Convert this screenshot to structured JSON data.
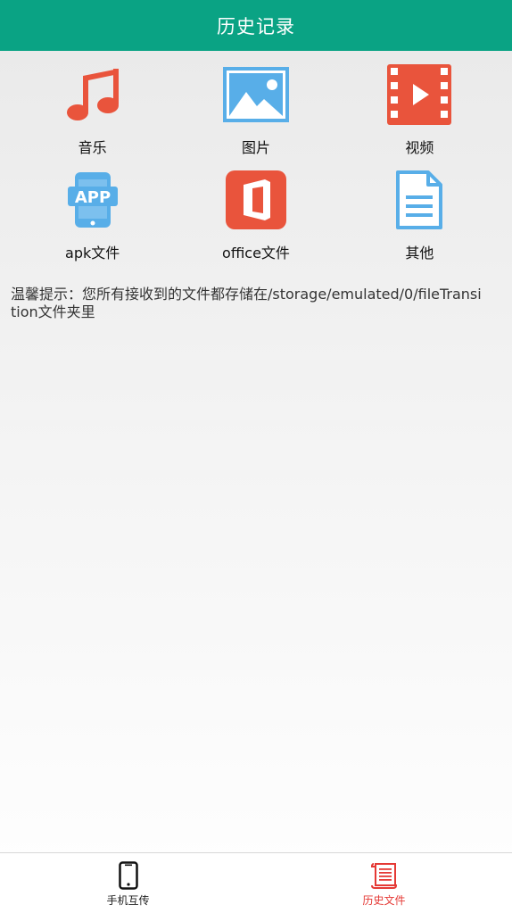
{
  "header": {
    "title": "历史记录"
  },
  "categories": [
    {
      "label": "音乐",
      "icon": "music-note-icon",
      "color": "#e9543c"
    },
    {
      "label": "图片",
      "icon": "picture-icon",
      "color": "#58aee8"
    },
    {
      "label": "视频",
      "icon": "video-film-icon",
      "color": "#e9543c"
    },
    {
      "label": "apk文件",
      "icon": "app-phone-icon",
      "color": "#58aee8"
    },
    {
      "label": "office文件",
      "icon": "office-icon",
      "color": "#e9543c"
    },
    {
      "label": "其他",
      "icon": "document-icon",
      "color": "#58aee8"
    }
  ],
  "tip": {
    "text": "温馨提示：您所有接收到的文件都存储在/storage/emulated/0/fileTransition文件夹里"
  },
  "bottom_nav": {
    "items": [
      {
        "label": "手机互传",
        "icon": "phone-icon",
        "active": false
      },
      {
        "label": "历史文件",
        "icon": "scroll-icon",
        "active": true
      }
    ]
  },
  "colors": {
    "header_bg": "#0aa384",
    "accent_red": "#e9543c",
    "accent_blue": "#58aee8",
    "active_nav": "#e53935"
  }
}
